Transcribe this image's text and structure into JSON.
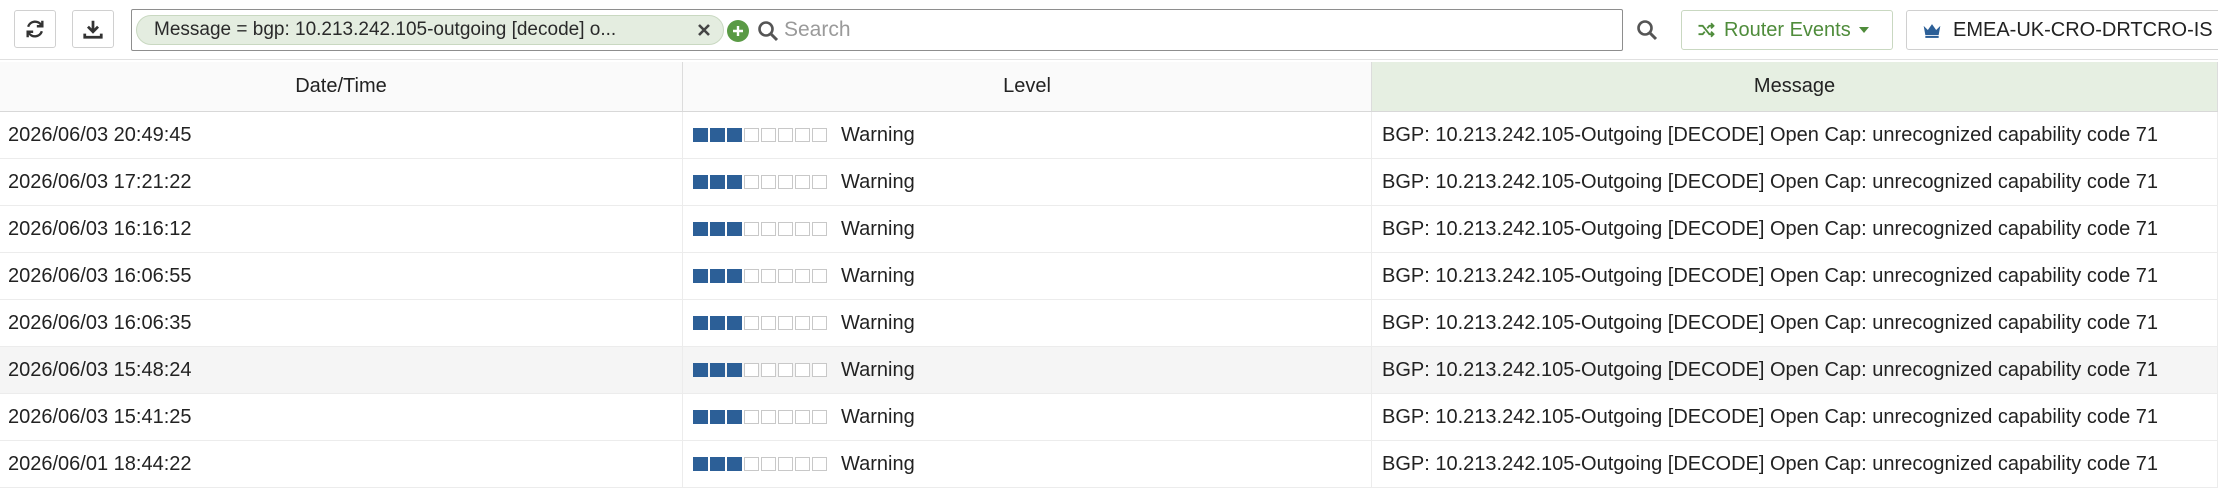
{
  "toolbar": {
    "refresh_icon": "refresh-icon",
    "download_icon": "download-icon",
    "filter_chip_text": "Message = bgp: 10.213.242.105-outgoing [decode] o...",
    "search_placeholder": "Search",
    "router_events_label": "Router Events",
    "device_label": "EMEA-UK-CRO-DRTCRO-IS"
  },
  "colors": {
    "accent_green": "#4f8c3b",
    "level_blue": "#2c5f97"
  },
  "table": {
    "columns": [
      "Date/Time",
      "Level",
      "Message"
    ],
    "rows": [
      {
        "datetime": "2026/06/03 20:49:45",
        "level": "Warning",
        "level_value": 3,
        "level_max": 8,
        "message": "BGP: 10.213.242.105-Outgoing [DECODE] Open Cap: unrecognized capability code 71"
      },
      {
        "datetime": "2026/06/03 17:21:22",
        "level": "Warning",
        "level_value": 3,
        "level_max": 8,
        "message": "BGP: 10.213.242.105-Outgoing [DECODE] Open Cap: unrecognized capability code 71"
      },
      {
        "datetime": "2026/06/03 16:16:12",
        "level": "Warning",
        "level_value": 3,
        "level_max": 8,
        "message": "BGP: 10.213.242.105-Outgoing [DECODE] Open Cap: unrecognized capability code 71"
      },
      {
        "datetime": "2026/06/03 16:06:55",
        "level": "Warning",
        "level_value": 3,
        "level_max": 8,
        "message": "BGP: 10.213.242.105-Outgoing [DECODE] Open Cap: unrecognized capability code 71"
      },
      {
        "datetime": "2026/06/03 16:06:35",
        "level": "Warning",
        "level_value": 3,
        "level_max": 8,
        "message": "BGP: 10.213.242.105-Outgoing [DECODE] Open Cap: unrecognized capability code 71"
      },
      {
        "datetime": "2026/06/03 15:48:24",
        "level": "Warning",
        "level_value": 3,
        "level_max": 8,
        "message": "BGP: 10.213.242.105-Outgoing [DECODE] Open Cap: unrecognized capability code 71"
      },
      {
        "datetime": "2026/06/03 15:41:25",
        "level": "Warning",
        "level_value": 3,
        "level_max": 8,
        "message": "BGP: 10.213.242.105-Outgoing [DECODE] Open Cap: unrecognized capability code 71"
      },
      {
        "datetime": "2026/06/01 18:44:22",
        "level": "Warning",
        "level_value": 3,
        "level_max": 8,
        "message": "BGP: 10.213.242.105-Outgoing [DECODE] Open Cap: unrecognized capability code 71"
      }
    ]
  }
}
